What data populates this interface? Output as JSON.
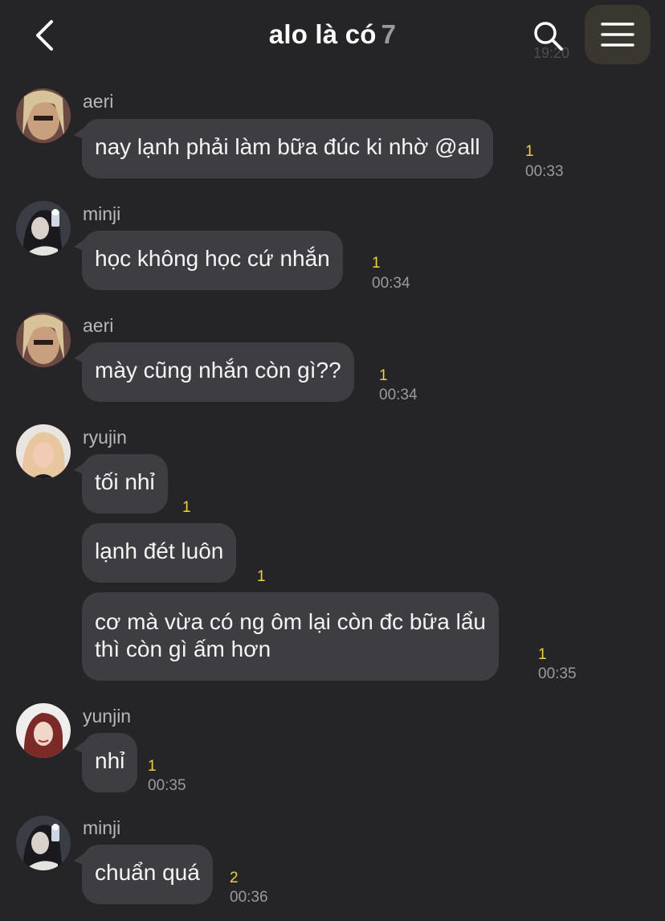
{
  "header": {
    "title": "alo là có",
    "member_count": "7",
    "back_icon": "chevron-left-icon",
    "search_icon": "search-icon",
    "menu_icon": "hamburger-menu-icon",
    "ghost_time": "19:20"
  },
  "messages": [
    {
      "sender": "aeri",
      "text": "nay lạnh phải làm bữa đúc ki nhờ @all",
      "unread": "1",
      "time": "00:33"
    },
    {
      "sender": "minji",
      "text": "học không học cứ nhắn",
      "unread": "1",
      "time": "00:34"
    },
    {
      "sender": "aeri",
      "text": "mày cũng nhắn còn gì??",
      "unread": "1",
      "time": "00:34"
    },
    {
      "sender": "ryujin",
      "text": "tối nhỉ",
      "unread": "1",
      "time": ""
    },
    {
      "sender": "",
      "text": "lạnh đét luôn",
      "unread": "1",
      "time": ""
    },
    {
      "sender": "",
      "text_line1": "cơ mà vừa có ng ôm lại còn đc bữa lẩu",
      "text_line2": "thì còn gì ấm hơn",
      "unread": "1",
      "time": "00:35"
    },
    {
      "sender": "yunjin",
      "text": "nhỉ",
      "unread": "1",
      "time": "00:35"
    },
    {
      "sender": "minji",
      "text": "chuẩn quá",
      "unread": "2",
      "time": "00:36"
    }
  ],
  "colors": {
    "background": "#252528",
    "bubble": "#3e3e42",
    "unread": "#f2d03c",
    "menu_button": "#3a3630"
  }
}
